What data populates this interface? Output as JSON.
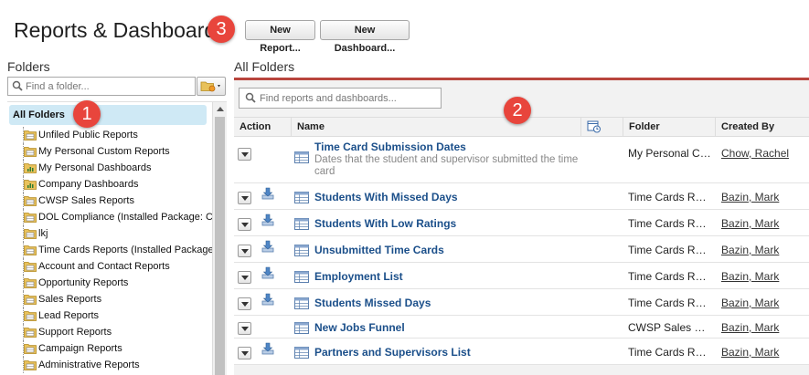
{
  "header": {
    "title": "Reports & Dashboards",
    "new_report_label": "New Report...",
    "new_dashboard_label": "New Dashboard..."
  },
  "annotations": {
    "badge1": "1",
    "badge2": "2",
    "badge3": "3"
  },
  "colors": {
    "accent_border": "#b8453d",
    "selected_folder": "#cfe9f5",
    "badge": "#e8453c",
    "link": "#1b4f8a"
  },
  "sidebar": {
    "heading": "Folders",
    "search_placeholder": "Find a folder...",
    "all_folders_label": "All Folders",
    "folders": [
      {
        "label": "Unfiled Public Reports",
        "icon": "report-folder-icon"
      },
      {
        "label": "My Personal Custom Reports",
        "icon": "report-folder-icon"
      },
      {
        "label": "My Personal Dashboards",
        "icon": "dashboard-folder-icon"
      },
      {
        "label": "Company Dashboards",
        "icon": "dashboard-folder-icon"
      },
      {
        "label": "CWSP Sales Reports",
        "icon": "report-folder-icon"
      },
      {
        "label": "DOL Compliance (Installed Package: C",
        "icon": "report-folder-icon"
      },
      {
        "label": "lkj",
        "icon": "report-folder-icon"
      },
      {
        "label": "Time Cards Reports (Installed Package",
        "icon": "report-folder-icon"
      },
      {
        "label": "Account and Contact Reports",
        "icon": "report-folder-icon"
      },
      {
        "label": "Opportunity Reports",
        "icon": "report-folder-icon"
      },
      {
        "label": "Sales Reports",
        "icon": "report-folder-icon"
      },
      {
        "label": "Lead Reports",
        "icon": "report-folder-icon"
      },
      {
        "label": "Support Reports",
        "icon": "report-folder-icon"
      },
      {
        "label": "Campaign Reports",
        "icon": "report-folder-icon"
      },
      {
        "label": "Administrative Reports",
        "icon": "report-folder-icon"
      }
    ]
  },
  "main": {
    "heading": "All Folders",
    "search_placeholder": "Find reports and dashboards...",
    "columns": {
      "action": "Action",
      "name": "Name",
      "folder": "Folder",
      "created_by": "Created By"
    },
    "rows": [
      {
        "name": "Time Card Submission Dates",
        "description": "Dates that the student and supervisor submitted the time card",
        "folder": "My Personal Custom Reports",
        "created_by": "Chow, Rachel",
        "has_download": false
      },
      {
        "name": "Students With Missed Days",
        "description": "",
        "folder": "Time Cards Reports (Installed Package)",
        "created_by": "Bazin, Mark",
        "has_download": true
      },
      {
        "name": "Students With Low Ratings",
        "description": "",
        "folder": "Time Cards Reports (Installed Package)",
        "created_by": "Bazin, Mark",
        "has_download": true
      },
      {
        "name": "Unsubmitted Time Cards",
        "description": "",
        "folder": "Time Cards Reports (Installed Package)",
        "created_by": "Bazin, Mark",
        "has_download": true
      },
      {
        "name": "Employment List",
        "description": "",
        "folder": "Time Cards Reports (Installed Package)",
        "created_by": "Bazin, Mark",
        "has_download": true
      },
      {
        "name": "Students Missed Days",
        "description": "",
        "folder": "Time Cards Reports (Installed Package)",
        "created_by": "Bazin, Mark",
        "has_download": true
      },
      {
        "name": "New Jobs Funnel",
        "description": "",
        "folder": "CWSP Sales Reports",
        "created_by": "Bazin, Mark",
        "has_download": false
      },
      {
        "name": "Partners and Supervisors List",
        "description": "",
        "folder": "Time Cards Reports (Installed Package)",
        "created_by": "Bazin, Mark",
        "has_download": true
      }
    ]
  }
}
